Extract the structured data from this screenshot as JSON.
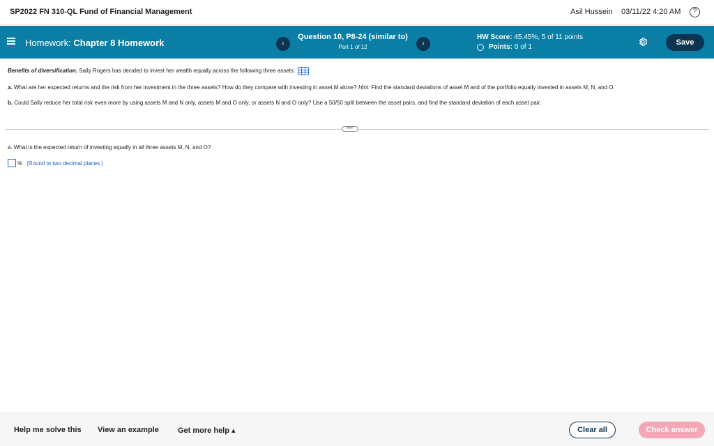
{
  "topbar": {
    "course_title": "SP2022 FN 310-QL Fund of Financial Management",
    "user_name": "Asil Hussein",
    "datetime": "03/11/22 4:20 AM",
    "help_glyph": "?"
  },
  "header": {
    "homework_prefix": "Homework:",
    "homework_name": "Chapter 8 Homework",
    "question_title": "Question 10, P8-24 (similar to)",
    "question_part": "Part 1 of 12",
    "hw_score_label": "HW Score:",
    "hw_score_value": "45.45%, 5 of 11 points",
    "points_label": "Points:",
    "points_value": "0 of 1",
    "save_label": "Save",
    "prev_glyph": "‹",
    "next_glyph": "›"
  },
  "question": {
    "intro_title": "Benefits of diversification.",
    "intro_text": "Sally Rogers has decided to invest her wealth equally across the following three assets:",
    "part_a_label": "a.",
    "part_a_text": "What are her expected returns and the risk from her investment in the three assets? How do they compare with investing in asset M alone?",
    "hint_label": "Hint:",
    "hint_text": "Find the standard deviations of asset M and of the portfolio equally invested in assets M, N, and O.",
    "part_b_label": "b.",
    "part_b_text": "Could Sally reduce her total risk even more by using assets M and N only, assets M and O only, or assets N and O only? Use a 50/50 split between the asset pairs, and find the standard deviation of each asset pair.",
    "expand_glyph": "•••"
  },
  "answer": {
    "prompt": "a. What is the expected return of investing equally in all three assets M, N, and O?",
    "input_value": "",
    "unit": "%",
    "round_hint": "(Round to two decimal places.)"
  },
  "footer": {
    "help_solve": "Help me solve this",
    "view_example": "View an example",
    "more_help": "Get more help ▴",
    "clear_all": "Clear all",
    "check_answer": "Check answer"
  },
  "colors": {
    "header_bg": "#0a7ea4",
    "dark_button": "#0b3550",
    "check_answer_disabled": "#f4a7b5",
    "link_blue": "#1e5fbf"
  }
}
